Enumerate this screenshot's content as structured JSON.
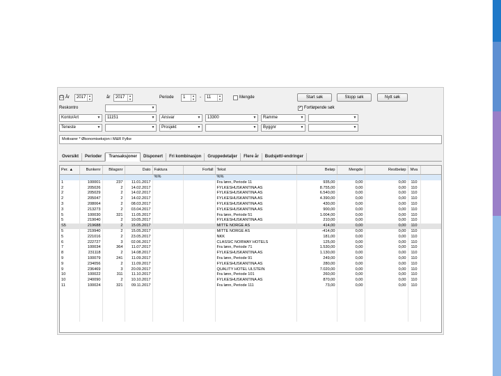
{
  "colors": {
    "accent_top": "#1e78c8",
    "accent_mid": "#5d8fd2",
    "accent_low": "#9a7fc8",
    "accent_bottom": "#8fb8e8"
  },
  "search": {
    "year_label": "År",
    "year_from": "2017",
    "year_to_label": "år",
    "year_to": "2017",
    "period_label": "Periode",
    "period_from": "1",
    "period_sep": "-",
    "period_to": "11",
    "quantity_label": "Mengde",
    "start_search": "Start søk",
    "stop_search": "Stopp søk",
    "new_search": "Nytt søk",
    "account_plan_label": "Reskontro",
    "continuous_search_label": "Fortløpende søk",
    "row1": {
      "f1": "Konto/Art",
      "v1": "11151",
      "f2": "Ansvar",
      "v2": "13300",
      "f3": "Ramme",
      "v3": ""
    },
    "row2": {
      "f1": "Teneste",
      "v1": "",
      "f2": "Prosjekt",
      "v2": "",
      "f3": "Byggnr",
      "v3": ""
    },
    "filter_text": "Motivarer * Økonomiseksjon i M&R Fylke"
  },
  "tabs": [
    "Oversikt",
    "Perioder",
    "Transaksjoner",
    "Disponert",
    "Fri kombinasjon",
    "Gruppedetaljer",
    "Flere år",
    "Budsjett/-endringer"
  ],
  "active_tab": "Transaksjoner",
  "grid": {
    "columns": [
      "Per.",
      "Bunkenr",
      "Bilagsnr",
      "Dato",
      "Faktura",
      "Forfall",
      "Tekst",
      "Beløp",
      "Mengde",
      "Restbeløp",
      "Mva"
    ],
    "filter_row": {
      "faktura": "%%",
      "tekst": "%%"
    },
    "rows": [
      [
        "1",
        "100001",
        "237",
        "11.01.2017",
        "",
        "",
        "Fra lønn, Periode 11",
        "935,00",
        "0,00",
        "0,00",
        "110"
      ],
      [
        "2",
        "205026",
        "2",
        "14.02.2017",
        "",
        "",
        "FYLKESHUSKANTINA AS",
        "8.755,00",
        "0,00",
        "0,00",
        "110"
      ],
      [
        "2",
        "205029",
        "2",
        "14.02.2017",
        "",
        "",
        "FYLKESHUSKANTINA AS",
        "6.540,00",
        "0,00",
        "0,00",
        "110"
      ],
      [
        "2",
        "205047",
        "2",
        "14.02.2017",
        "",
        "",
        "FYLKESHUSKANTINA AS",
        "4.390,00",
        "0,00",
        "0,00",
        "110"
      ],
      [
        "3",
        "208064",
        "2",
        "08.03.2017",
        "",
        "",
        "FYLKESHUSKANTINA AS",
        "430,00",
        "0,00",
        "0,00",
        "110"
      ],
      [
        "3",
        "213273",
        "2",
        "03.04.2017",
        "",
        "",
        "FYLKESHUSKANTINA AS",
        "900,00",
        "0,00",
        "0,00",
        "110"
      ],
      [
        "5",
        "100030",
        "321",
        "11.05.2017",
        "",
        "",
        "Fra lønn, Periode 51",
        "1.004,00",
        "0,00",
        "0,00",
        "110"
      ],
      [
        "5",
        "219040",
        "2",
        "10.05.2017",
        "",
        "",
        "FYLKESHUSKANTINA AS",
        "210,00",
        "0,00",
        "0,00",
        "110"
      ],
      [
        "5",
        "219688",
        "2",
        "15.05.2017",
        "",
        "",
        "MITTE NORGE AS",
        "414,00",
        "0,00",
        "0,00",
        "110"
      ],
      [
        "5",
        "219940",
        "2",
        "15.05.2017",
        "",
        "",
        "MITTE NORGE AS",
        "-414,00",
        "0,00",
        "0,00",
        "110"
      ],
      [
        "5",
        "221016",
        "2",
        "23.05.2017",
        "",
        "",
        "NKK",
        "181,00",
        "0,00",
        "0,00",
        "110"
      ],
      [
        "6",
        "222727",
        "3",
        "02.06.2017",
        "",
        "",
        "CLASSIC NORWAY HOTELS",
        "125,00",
        "0,00",
        "0,00",
        "110"
      ],
      [
        "7",
        "100034",
        "364",
        "11.07.2017",
        "",
        "",
        "Fra lønn, Periode 71",
        "1.530,00",
        "0,00",
        "0,00",
        "110"
      ],
      [
        "8",
        "231118",
        "2",
        "14.08.2017",
        "",
        "",
        "FYLKESHUSKANTINA AS",
        "1.130,00",
        "0,00",
        "0,00",
        "110"
      ],
      [
        "9",
        "100079",
        "241",
        "11.09.2017",
        "",
        "",
        "Fra lønn, Periode 91",
        "249,00",
        "0,00",
        "0,00",
        "110"
      ],
      [
        "9",
        "234056",
        "2",
        "11.09.2017",
        "",
        "",
        "FYLKESHUSKANTINA AS",
        "280,00",
        "0,00",
        "0,00",
        "110"
      ],
      [
        "9",
        "236469",
        "3",
        "20.09.2017",
        "",
        "",
        "QUALITY HOTEL ULSTEIN",
        "7.020,00",
        "0,00",
        "0,00",
        "110"
      ],
      [
        "10",
        "100022",
        "311",
        "11.10.2017",
        "",
        "",
        "Fra lønn, Periode 101",
        "260,00",
        "0,00",
        "0,00",
        "110"
      ],
      [
        "10",
        "240090",
        "2",
        "10.10.2017",
        "",
        "",
        "FYLKESHUSKANTINA AS",
        "870,00",
        "0,00",
        "0,00",
        "110"
      ],
      [
        "11",
        "100024",
        "321",
        "09.11.2017",
        "",
        "",
        "Fra lønn, Periode 111",
        "73,00",
        "0,00",
        "0,00",
        "110"
      ]
    ],
    "selected_row_index": 8,
    "selected_marker": "S"
  }
}
